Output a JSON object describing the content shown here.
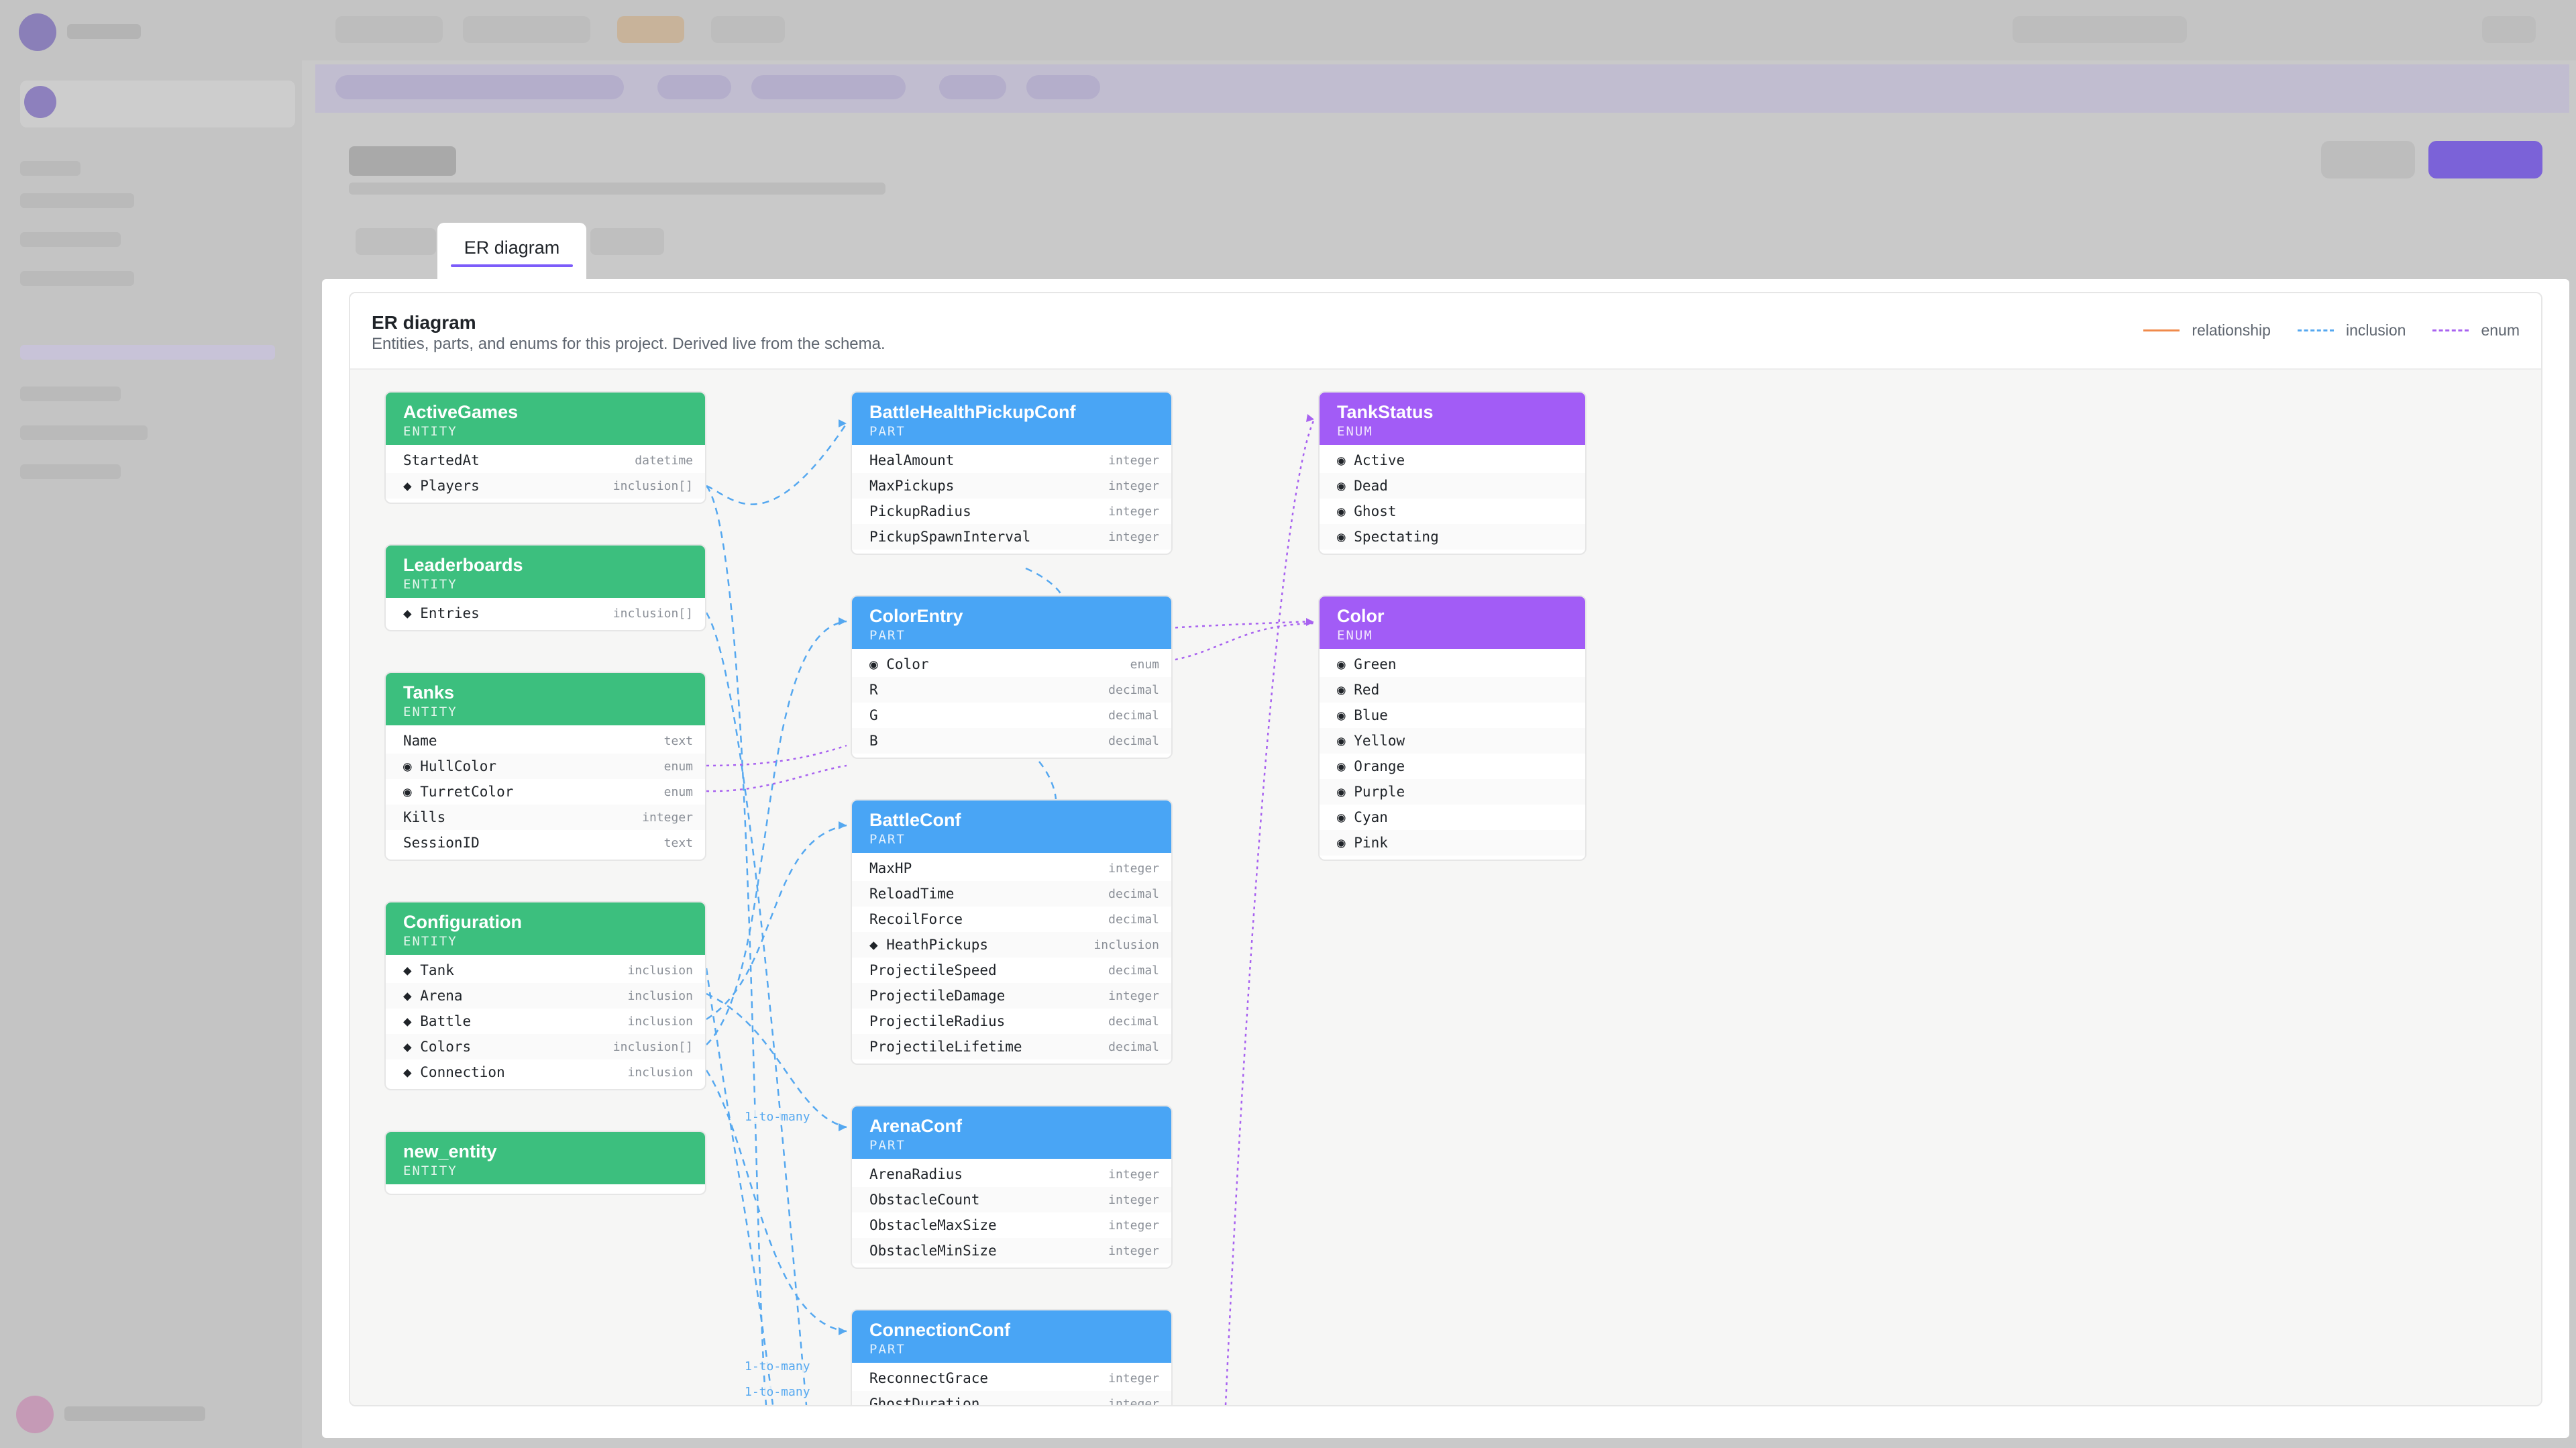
{
  "tab": {
    "label": "ER diagram"
  },
  "header": {
    "title": "ER diagram",
    "subtitle": "Entities, parts, and enums for this project. Derived live from the schema."
  },
  "legend": {
    "relationship": "relationship",
    "inclusion": "inclusion",
    "enum": "enum",
    "colors": {
      "relationship": "#f08a4b",
      "inclusion": "#55a8f0",
      "enum": "#a862f0"
    }
  },
  "colors": {
    "entity": "#3cbf7e",
    "part": "#49a5f5",
    "enum": "#a25cf6",
    "accent": "#7c5cfa"
  },
  "edge_labels": [
    "1-to-many",
    "1-to-many",
    "1-to-many"
  ],
  "nodes": {
    "ActiveGames": {
      "name": "ActiveGames",
      "kind": "ENTITY",
      "fields": [
        {
          "name": "StartedAt",
          "type": "datetime"
        },
        {
          "name": "◆ Players",
          "type": "inclusion[]"
        }
      ]
    },
    "Leaderboards": {
      "name": "Leaderboards",
      "kind": "ENTITY",
      "fields": [
        {
          "name": "◆ Entries",
          "type": "inclusion[]"
        }
      ]
    },
    "Tanks": {
      "name": "Tanks",
      "kind": "ENTITY",
      "fields": [
        {
          "name": "Name",
          "type": "text"
        },
        {
          "name": "◉ HullColor",
          "type": "enum"
        },
        {
          "name": "◉ TurretColor",
          "type": "enum"
        },
        {
          "name": "Kills",
          "type": "integer"
        },
        {
          "name": "SessionID",
          "type": "text"
        }
      ]
    },
    "Configuration": {
      "name": "Configuration",
      "kind": "ENTITY",
      "fields": [
        {
          "name": "◆ Tank",
          "type": "inclusion"
        },
        {
          "name": "◆ Arena",
          "type": "inclusion"
        },
        {
          "name": "◆ Battle",
          "type": "inclusion"
        },
        {
          "name": "◆ Colors",
          "type": "inclusion[]"
        },
        {
          "name": "◆ Connection",
          "type": "inclusion"
        }
      ]
    },
    "new_entity": {
      "name": "new_entity",
      "kind": "ENTITY",
      "fields": []
    },
    "BattleHealthPickupConf": {
      "name": "BattleHealthPickupConf",
      "kind": "PART",
      "fields": [
        {
          "name": "HealAmount",
          "type": "integer"
        },
        {
          "name": "MaxPickups",
          "type": "integer"
        },
        {
          "name": "PickupRadius",
          "type": "integer"
        },
        {
          "name": "PickupSpawnInterval",
          "type": "integer"
        }
      ]
    },
    "ColorEntry": {
      "name": "ColorEntry",
      "kind": "PART",
      "fields": [
        {
          "name": "◉ Color",
          "type": "enum"
        },
        {
          "name": "R",
          "type": "decimal"
        },
        {
          "name": "G",
          "type": "decimal"
        },
        {
          "name": "B",
          "type": "decimal"
        }
      ]
    },
    "BattleConf": {
      "name": "BattleConf",
      "kind": "PART",
      "fields": [
        {
          "name": "MaxHP",
          "type": "integer"
        },
        {
          "name": "ReloadTime",
          "type": "decimal"
        },
        {
          "name": "RecoilForce",
          "type": "decimal"
        },
        {
          "name": "◆ HeathPickups",
          "type": "inclusion"
        },
        {
          "name": "ProjectileSpeed",
          "type": "decimal"
        },
        {
          "name": "ProjectileDamage",
          "type": "integer"
        },
        {
          "name": "ProjectileRadius",
          "type": "decimal"
        },
        {
          "name": "ProjectileLifetime",
          "type": "decimal"
        }
      ]
    },
    "ArenaConf": {
      "name": "ArenaConf",
      "kind": "PART",
      "fields": [
        {
          "name": "ArenaRadius",
          "type": "integer"
        },
        {
          "name": "ObstacleCount",
          "type": "integer"
        },
        {
          "name": "ObstacleMaxSize",
          "type": "integer"
        },
        {
          "name": "ObstacleMinSize",
          "type": "integer"
        }
      ]
    },
    "ConnectionConf": {
      "name": "ConnectionConf",
      "kind": "PART",
      "fields": [
        {
          "name": "ReconnectGrace",
          "type": "integer"
        },
        {
          "name": "GhostDuration",
          "type": "integer"
        }
      ]
    },
    "TankStatus": {
      "name": "TankStatus",
      "kind": "ENUM",
      "fields": [
        {
          "name": "◉ Active",
          "type": ""
        },
        {
          "name": "◉ Dead",
          "type": ""
        },
        {
          "name": "◉ Ghost",
          "type": ""
        },
        {
          "name": "◉ Spectating",
          "type": ""
        }
      ]
    },
    "Color": {
      "name": "Color",
      "kind": "ENUM",
      "fields": [
        {
          "name": "◉ Green",
          "type": ""
        },
        {
          "name": "◉ Red",
          "type": ""
        },
        {
          "name": "◉ Blue",
          "type": ""
        },
        {
          "name": "◉ Yellow",
          "type": ""
        },
        {
          "name": "◉ Orange",
          "type": ""
        },
        {
          "name": "◉ Purple",
          "type": ""
        },
        {
          "name": "◉ Cyan",
          "type": ""
        },
        {
          "name": "◉ Pink",
          "type": ""
        }
      ]
    }
  }
}
